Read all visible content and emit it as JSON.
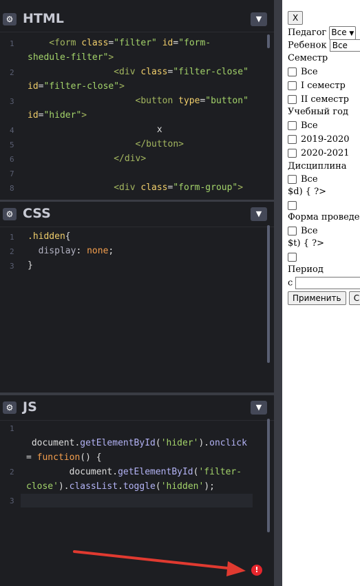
{
  "panels": {
    "html": {
      "title": "HTML",
      "line_numbers": [
        "1",
        "2",
        "3",
        "4",
        "5",
        "6",
        "7",
        "8"
      ],
      "lines": [
        [
          {
            "t": "    <form ",
            "c": "tag"
          },
          {
            "t": "class",
            "c": "attr"
          },
          {
            "t": "=",
            "c": "plain"
          },
          {
            "t": "\"filter\"",
            "c": "str"
          },
          {
            "t": " id",
            "c": "attr"
          },
          {
            "t": "=",
            "c": "plain"
          },
          {
            "t": "\"form-",
            "c": "str"
          }
        ],
        [
          {
            "t": "shedule-filter\"",
            "c": "str"
          },
          {
            "t": ">",
            "c": "tag"
          }
        ],
        [
          {
            "t": "                <div ",
            "c": "tag"
          },
          {
            "t": "class",
            "c": "attr"
          },
          {
            "t": "=",
            "c": "plain"
          },
          {
            "t": "\"filter-close\"",
            "c": "str"
          }
        ],
        [
          {
            "t": "id",
            "c": "attr"
          },
          {
            "t": "=",
            "c": "plain"
          },
          {
            "t": "\"filter-close\"",
            "c": "str"
          },
          {
            "t": ">",
            "c": "tag"
          }
        ],
        [
          {
            "t": "                    <button ",
            "c": "tag"
          },
          {
            "t": "type",
            "c": "attr"
          },
          {
            "t": "=",
            "c": "plain"
          },
          {
            "t": "\"button\"",
            "c": "str"
          }
        ],
        [
          {
            "t": "id",
            "c": "attr"
          },
          {
            "t": "=",
            "c": "plain"
          },
          {
            "t": "\"hider\"",
            "c": "str"
          },
          {
            "t": ">",
            "c": "tag"
          }
        ],
        [
          {
            "t": "                        x",
            "c": "plain"
          }
        ],
        [
          {
            "t": "                    </button>",
            "c": "tag"
          }
        ],
        [
          {
            "t": "                </div>",
            "c": "tag"
          }
        ],
        [
          {
            "t": "",
            "c": "plain"
          }
        ],
        [
          {
            "t": "                <div ",
            "c": "tag"
          },
          {
            "t": "class",
            "c": "attr"
          },
          {
            "t": "=",
            "c": "plain"
          },
          {
            "t": "\"form-group\"",
            "c": "str"
          },
          {
            "t": ">",
            "c": "tag"
          }
        ]
      ]
    },
    "css": {
      "title": "CSS",
      "line_numbers": [
        "1",
        "2",
        "3"
      ],
      "lines": [
        [
          {
            "t": ".hidden",
            "c": "sel"
          },
          {
            "t": "{",
            "c": "plain"
          }
        ],
        [
          {
            "t": "  display",
            "c": "cssprop"
          },
          {
            "t": ": ",
            "c": "plain"
          },
          {
            "t": "none",
            "c": "kw"
          },
          {
            "t": ";",
            "c": "plain"
          }
        ],
        [
          {
            "t": "}",
            "c": "plain"
          }
        ]
      ]
    },
    "js": {
      "title": "JS",
      "line_numbers": [
        "1",
        "2",
        "3"
      ],
      "lines": [
        [
          {
            "t": "",
            "c": "plain"
          }
        ],
        [
          {
            "t": " document",
            "c": "plain"
          },
          {
            "t": ".",
            "c": "plain"
          },
          {
            "t": "getElementById",
            "c": "prop"
          },
          {
            "t": "(",
            "c": "plain"
          },
          {
            "t": "'hider'",
            "c": "str"
          },
          {
            "t": ").",
            "c": "plain"
          },
          {
            "t": "onclick",
            "c": "prop"
          }
        ],
        [
          {
            "t": "= ",
            "c": "plain"
          },
          {
            "t": "function",
            "c": "kw"
          },
          {
            "t": "() {",
            "c": "plain"
          }
        ],
        [
          {
            "t": "        document",
            "c": "plain"
          },
          {
            "t": ".",
            "c": "plain"
          },
          {
            "t": "getElementById",
            "c": "prop"
          },
          {
            "t": "(",
            "c": "plain"
          },
          {
            "t": "'filter-",
            "c": "str"
          }
        ],
        [
          {
            "t": "close'",
            "c": "str"
          },
          {
            "t": ").",
            "c": "plain"
          },
          {
            "t": "classList",
            "c": "prop"
          },
          {
            "t": ".",
            "c": "plain"
          },
          {
            "t": "toggle",
            "c": "prop"
          },
          {
            "t": "(",
            "c": "plain"
          },
          {
            "t": "'hidden'",
            "c": "str"
          },
          {
            "t": ");",
            "c": "plain"
          }
        ]
      ]
    }
  },
  "icons": {
    "gear": "gear-icon",
    "chevron": "chevron-down-icon",
    "error": "error-icon"
  },
  "preview": {
    "close_button": "X",
    "teacher_label": "Педагог",
    "teacher_select": "Все",
    "child_label": "Ребенок",
    "child_input": "Все",
    "semester_heading": "Семестр",
    "semester_options": [
      "Все",
      "I семестр",
      "II семестр"
    ],
    "year_heading": "Учебный год",
    "year_options": [
      "Все",
      "2019-2020",
      "2020-2021"
    ],
    "discipline_heading": "Дисциплина",
    "discipline_options": [
      "Все"
    ],
    "discipline_stray": "$d) { ?>",
    "form_heading": "Форма проведе",
    "form_options": [
      "Все"
    ],
    "form_stray": "$t) { ?>",
    "period_heading": "Период",
    "period_from": "с",
    "apply_button": "Применить",
    "other_button": "С"
  }
}
